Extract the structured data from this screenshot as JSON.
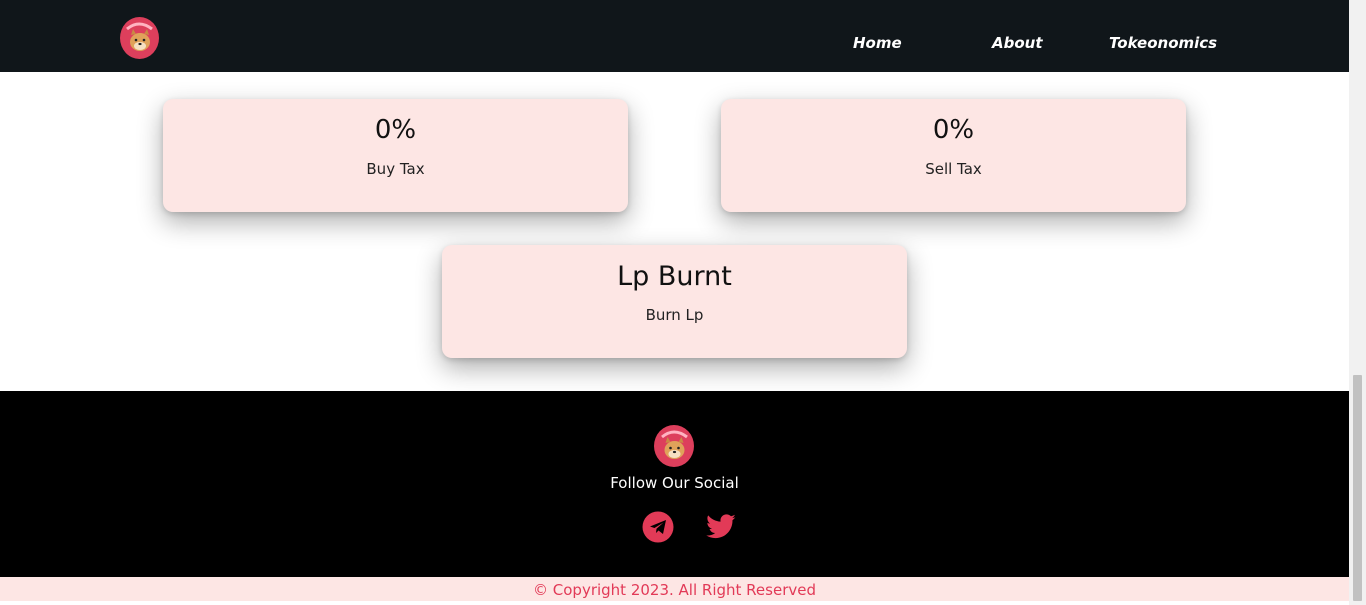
{
  "nav": {
    "logo_icon": "doge-mascot-logo",
    "links": [
      {
        "label": "Home"
      },
      {
        "label": "About"
      },
      {
        "label": "Tokeonomics"
      }
    ]
  },
  "cards": {
    "buy": {
      "value": "0%",
      "label": "Buy Tax"
    },
    "sell": {
      "value": "0%",
      "label": "Sell Tax"
    },
    "lp": {
      "value": "Lp Burnt",
      "label": "Burn Lp"
    }
  },
  "footer": {
    "logo_icon": "doge-mascot-logo",
    "title": "Follow Our Social",
    "socials": [
      {
        "icon": "telegram-icon"
      },
      {
        "icon": "twitter-icon"
      }
    ],
    "copyright": "© Copyright 2023. All Right Reserved"
  },
  "colors": {
    "nav_bg": "#10161a",
    "card_bg": "#fde6e4",
    "accent": "#e23a57",
    "footer_bg": "#000000"
  }
}
